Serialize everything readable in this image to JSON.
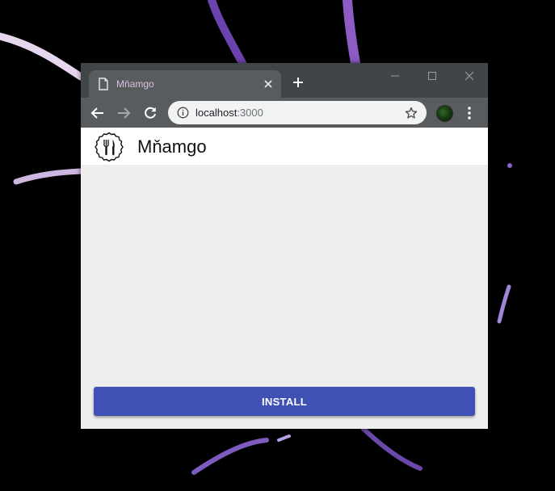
{
  "browser": {
    "tab_title": "Mňamgo",
    "url_host": "localhost",
    "url_port": ":3000"
  },
  "app": {
    "title": "Mňamgo",
    "install_label": "INSTALL",
    "accent_color": "#3f51b5"
  },
  "icons": {
    "tab": "page-icon",
    "close": "close-icon",
    "new_tab": "plus-icon",
    "back": "arrow-left-icon",
    "forward": "arrow-right-icon",
    "reload": "reload-icon",
    "site_info": "info-icon",
    "bookmark": "star-icon",
    "menu": "kebab-menu-icon",
    "logo": "fork-knife-icon"
  }
}
